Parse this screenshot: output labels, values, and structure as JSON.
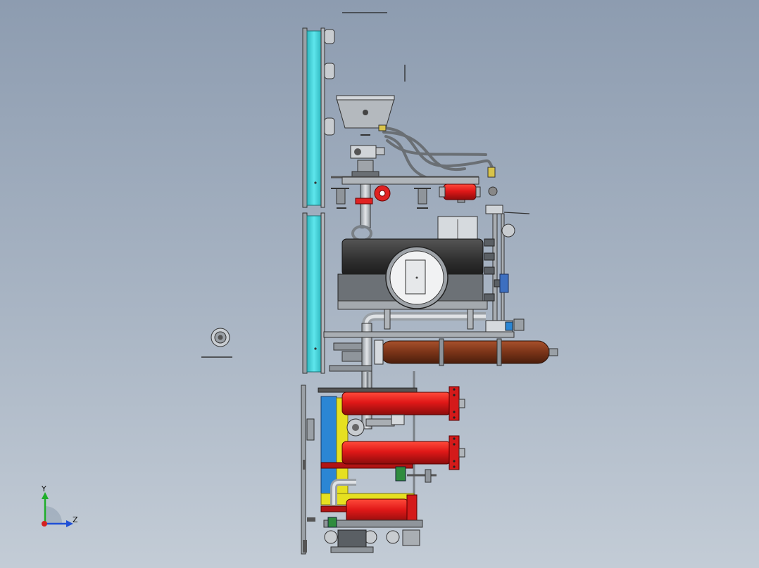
{
  "viewport": {
    "background_top": "#8d9cb0",
    "background_bottom": "#c3ccd6"
  },
  "triad": {
    "y_label": "Y",
    "z_label": "Z",
    "y_color": "#1fae2a",
    "z_color": "#1f4fd6",
    "x_color": "#d42020"
  },
  "colors": {
    "panel_cyan": "#3fd0d8",
    "vessel_red": "#e01818",
    "tank_brown": "#7a3418",
    "motor_dark": "#3a3a3a",
    "pump_silver": "#d6dade",
    "pipe_grey": "#b7bcc2",
    "base_yellow": "#e6e020",
    "base_blue": "#2b86d4"
  }
}
